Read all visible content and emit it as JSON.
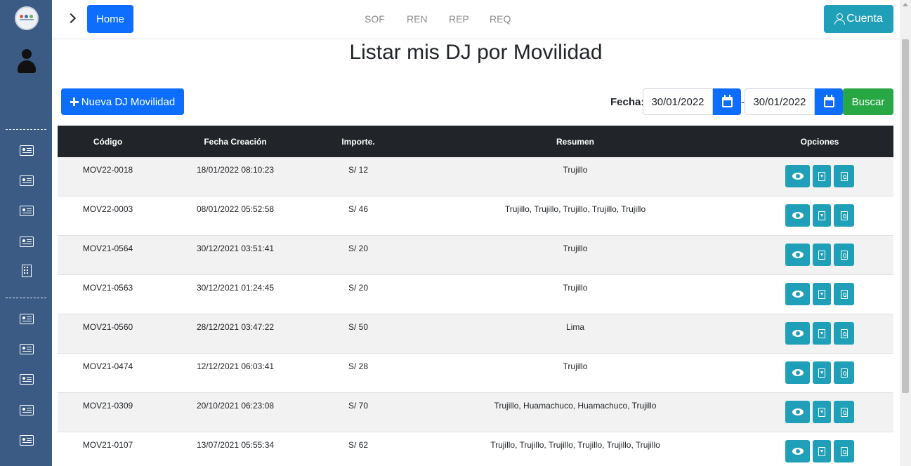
{
  "topbar": {
    "home_label": "Home",
    "nav": [
      "SOF",
      "REN",
      "REP",
      "REQ"
    ],
    "cuenta_label": "Cuenta"
  },
  "page": {
    "title": "Listar mis DJ por Movilidad",
    "new_button_label": "Nueva DJ Movilidad",
    "fecha_label": "Fecha:",
    "date_from": "30/01/2022",
    "date_separator": "-",
    "date_to": "30/01/2022",
    "search_label": "Buscar"
  },
  "table": {
    "headers": [
      "Código",
      "Fecha Creación",
      "Importe.",
      "Resumen",
      "Opciones"
    ],
    "rows": [
      {
        "codigo": "MOV22-0018",
        "fecha": "18/01/2022 08:10:23",
        "importe": "S/ 12",
        "resumen": "Trujillo"
      },
      {
        "codigo": "MOV22-0003",
        "fecha": "08/01/2022 05:52:58",
        "importe": "S/ 46",
        "resumen": "Trujillo, Trujillo, Trujillo, Trujillo, Trujillo"
      },
      {
        "codigo": "MOV21-0564",
        "fecha": "30/12/2021 03:51:41",
        "importe": "S/ 20",
        "resumen": "Trujillo"
      },
      {
        "codigo": "MOV21-0563",
        "fecha": "30/12/2021 01:24:45",
        "importe": "S/ 20",
        "resumen": "Trujillo"
      },
      {
        "codigo": "MOV21-0560",
        "fecha": "28/12/2021 03:47:22",
        "importe": "S/ 50",
        "resumen": "Lima"
      },
      {
        "codigo": "MOV21-0474",
        "fecha": "12/12/2021 06:03:41",
        "importe": "S/ 28",
        "resumen": "Trujillo"
      },
      {
        "codigo": "MOV21-0309",
        "fecha": "20/10/2021 06:23:08",
        "importe": "S/ 70",
        "resumen": "Trujillo, Huamachuco, Huamachuco, Trujillo"
      },
      {
        "codigo": "MOV21-0107",
        "fecha": "13/07/2021 05:55:34",
        "importe": "S/ 62",
        "resumen": "Trujillo, Trujillo, Trujillo, Trujillo, Trujillo, Trujillo"
      }
    ]
  },
  "sidebar": {
    "icons": [
      "id-card-icon",
      "id-card-icon",
      "id-card-icon",
      "id-card-icon",
      "building-icon",
      "id-card-icon",
      "id-card-icon",
      "id-card-icon",
      "id-card-icon",
      "id-card-icon"
    ]
  },
  "colors": {
    "sidebar": "#3b5b85",
    "primary": "#0d6efd",
    "info": "#20a0b8",
    "success": "#28a745",
    "table_header": "#212529"
  }
}
